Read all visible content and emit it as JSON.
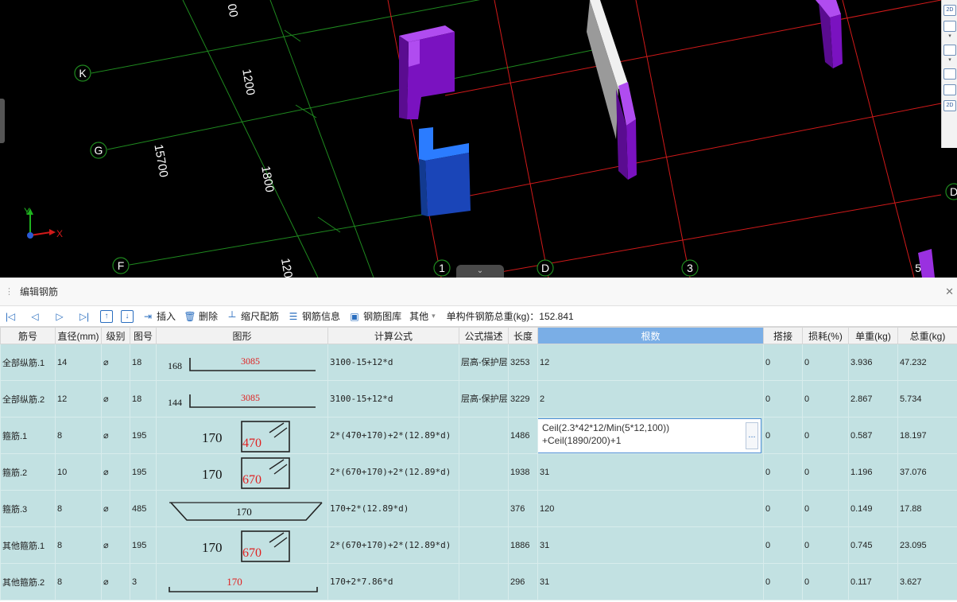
{
  "viewport": {
    "axis_labels": {
      "k": "K",
      "g": "G",
      "f": "F",
      "d": "D",
      "n1": "1",
      "n3": "3",
      "n5": "5",
      "d_right": "D"
    },
    "dimensions": {
      "top": "00",
      "d1200": "1200",
      "d15700": "15700",
      "d1800": "1800",
      "d120": "120"
    },
    "triad": {
      "x": "X",
      "y": "Y"
    },
    "collapse_icon": "chevron-down-icon",
    "right_toolbar": {
      "btn_2d": "2D",
      "btn_2d_b": "2D"
    },
    "colors": {
      "grid_green": "#1f8a1f",
      "grid_red": "#d11a1a",
      "column_purple": "#8d17d6",
      "column_blue": "#1a5bd6"
    }
  },
  "panel": {
    "title": "编辑钢筋",
    "close_icon": "close-icon",
    "toolbar": {
      "insert": "插入",
      "delete": "删除",
      "scale_rebar": "缩尺配筋",
      "rebar_info": "钢筋信息",
      "rebar_library": "钢筋图库",
      "other": "其他",
      "total_weight_label": "单构件钢筋总重(kg)：152.841"
    },
    "columns": [
      "筋号",
      "直径(mm)",
      "级别",
      "图号",
      "图形",
      "计算公式",
      "公式描述",
      "长度",
      "根数",
      "搭接",
      "损耗(%)",
      "单重(kg)",
      "总重(kg)"
    ],
    "rows": [
      {
        "name": "全部纵筋.1",
        "dia": "14",
        "grade": "⌀",
        "fig": "18",
        "shape": {
          "left": "168",
          "main": "3085"
        },
        "formula": "3100-15+12*d",
        "desc": "层高-保护层+弯折",
        "length": "3253",
        "count": "12",
        "lap": "0",
        "loss": "0",
        "unit": "3.936",
        "total": "47.232"
      },
      {
        "name": "全部纵筋.2",
        "dia": "12",
        "grade": "⌀",
        "fig": "18",
        "shape": {
          "left": "144",
          "main": "3085"
        },
        "formula": "3100-15+12*d",
        "desc": "层高-保护层+弯折",
        "length": "3229",
        "count": "2",
        "lap": "0",
        "loss": "0",
        "unit": "2.867",
        "total": "5.734"
      },
      {
        "name": "箍筋.1",
        "dia": "8",
        "grade": "⌀",
        "fig": "195",
        "shape": {
          "left": "170",
          "main": "470"
        },
        "formula": "2*(470+170)+2*(12.89*d)",
        "desc": "",
        "length": "1486",
        "count_line1": "Ceil(2.3*42*12/Min(5*12,100))",
        "count_line2": "+Ceil(1890/200)+1",
        "ellipsis": "...",
        "lap": "0",
        "loss": "0",
        "unit": "0.587",
        "total": "18.197"
      },
      {
        "name": "箍筋.2",
        "dia": "10",
        "grade": "⌀",
        "fig": "195",
        "shape": {
          "left": "170",
          "main": "670"
        },
        "formula": "2*(670+170)+2*(12.89*d)",
        "desc": "",
        "length": "1938",
        "count": "31",
        "lap": "0",
        "loss": "0",
        "unit": "1.196",
        "total": "37.076"
      },
      {
        "name": "箍筋.3",
        "dia": "8",
        "grade": "⌀",
        "fig": "485",
        "shape": {
          "main": "170"
        },
        "formula": "170+2*(12.89*d)",
        "desc": "",
        "length": "376",
        "count": "120",
        "lap": "0",
        "loss": "0",
        "unit": "0.149",
        "total": "17.88"
      },
      {
        "name": "其他箍筋.1",
        "dia": "8",
        "grade": "⌀",
        "fig": "195",
        "shape": {
          "left": "170",
          "main": "670"
        },
        "formula": "2*(670+170)+2*(12.89*d)",
        "desc": "",
        "length": "1886",
        "count": "31",
        "lap": "0",
        "loss": "0",
        "unit": "0.745",
        "total": "23.095"
      },
      {
        "name": "其他箍筋.2",
        "dia": "8",
        "grade": "⌀",
        "fig": "3",
        "shape": {
          "main": "170"
        },
        "formula": "170+2*7.86*d",
        "desc": "",
        "length": "296",
        "count": "31",
        "lap": "0",
        "loss": "0",
        "unit": "0.117",
        "total": "3.627"
      }
    ]
  }
}
